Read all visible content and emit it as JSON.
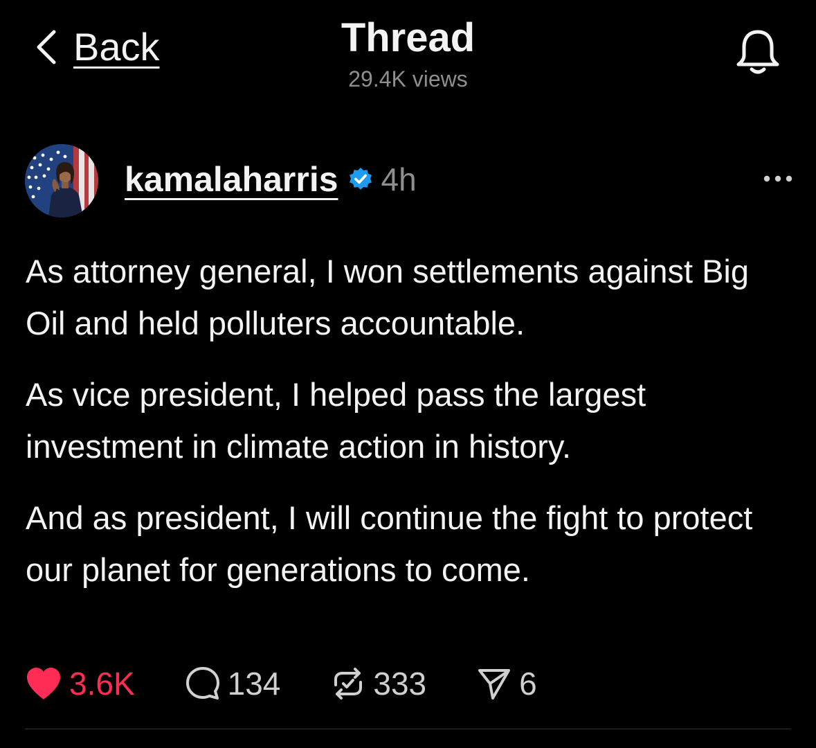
{
  "header": {
    "back_label": "Back",
    "title": "Thread",
    "views": "29.4K views"
  },
  "post": {
    "username": "kamalaharris",
    "time": "4h",
    "paragraphs": [
      "As attorney general, I won settlements against Big Oil and held polluters accountable.",
      "As vice president, I helped pass the largest investment in climate action in history.",
      "And as president, I will continue the fight to protect our planet for generations to come."
    ],
    "actions": {
      "likes": "3.6K",
      "replies": "134",
      "reposts": "333",
      "shares": "6"
    }
  },
  "colors": {
    "background": "#000000",
    "text": "#f3f3f3",
    "muted": "#8e8e8e",
    "like_red": "#ff2d55",
    "verified_blue": "#1d9bf0"
  },
  "icons": {
    "back": "chevron-left-icon",
    "notifications": "bell-icon",
    "verified": "verified-badge-icon",
    "more": "more-horizontal-icon",
    "like": "heart-filled-icon",
    "reply": "comment-icon",
    "repost": "repost-icon",
    "share": "send-icon"
  }
}
